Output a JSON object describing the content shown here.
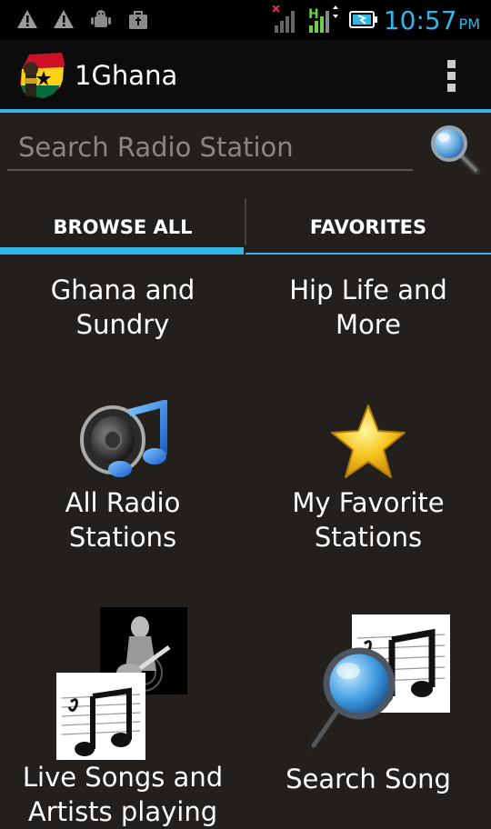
{
  "status_bar": {
    "time": "10:57",
    "ampm": "PM",
    "network_label": "H"
  },
  "app": {
    "title": "1Ghana"
  },
  "search": {
    "placeholder": "Search Radio Station"
  },
  "tabs": [
    {
      "label": "BROWSE ALL",
      "active": true
    },
    {
      "label": "FAVORITES",
      "active": false
    }
  ],
  "grid": {
    "items": [
      {
        "label": "Ghana and\nSundry"
      },
      {
        "label": "Hip Life and\nMore"
      },
      {
        "label": "All Radio\nStations",
        "icon": "speaker-music-icon"
      },
      {
        "label": "My Favorite\nStations",
        "icon": "star-icon"
      },
      {
        "label": "Live Songs and\nArtists playing",
        "icon": "guitarist-music-icon"
      },
      {
        "label": "Search Song",
        "icon": "search-music-icon"
      }
    ]
  },
  "colors": {
    "accent": "#33b5e5",
    "background": "#221f1c",
    "action_bar": "#0c0c0c"
  }
}
